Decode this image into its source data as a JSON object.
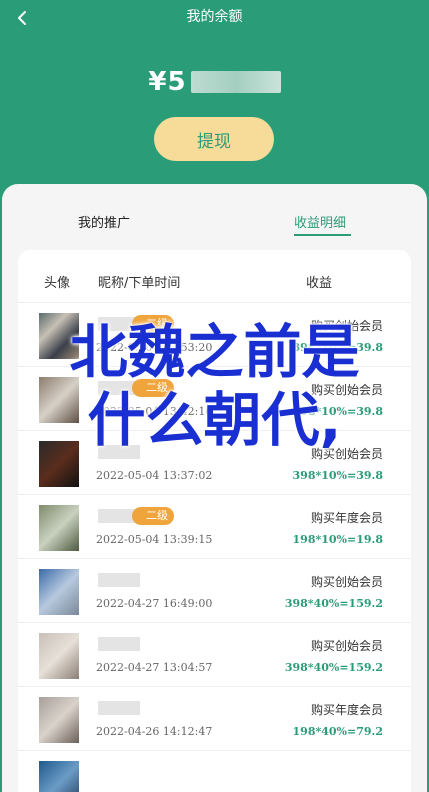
{
  "header": {
    "title": "我的余额"
  },
  "balance": {
    "amount": "¥5"
  },
  "buttons": {
    "withdraw": "提现"
  },
  "tabs": [
    {
      "label": "我的推广"
    },
    {
      "label": "收益明细"
    }
  ],
  "table": {
    "headers": [
      "头像",
      "昵称/下单时间",
      "收益"
    ],
    "rows": [
      {
        "level": "二级",
        "time": "2022-05-04 13:53:20",
        "desc": "购买创始会员",
        "calc": "398*10%=39.8"
      },
      {
        "level": "二级",
        "time": "2022-05-04 13:42:16",
        "desc": "购买创始会员",
        "calc": "398*10%=39.8"
      },
      {
        "level": "",
        "time": "2022-05-04 13:37:02",
        "desc": "购买创始会员",
        "calc": "398*10%=39.8"
      },
      {
        "level": "二级",
        "time": "2022-05-04 13:39:15",
        "desc": "购买年度会员",
        "calc": "198*10%=19.8"
      },
      {
        "level": "",
        "time": "2022-04-27 16:49:00",
        "desc": "购买创始会员",
        "calc": "398*40%=159.2"
      },
      {
        "level": "",
        "time": "2022-04-27 13:04:57",
        "desc": "购买创始会员",
        "calc": "398*40%=159.2"
      },
      {
        "level": "",
        "time": "2022-04-26 14:12:47",
        "desc": "购买年度会员",
        "calc": "198*40%=79.2"
      }
    ]
  },
  "watermark": {
    "line1": "北魏之前是",
    "line2": "什么朝代,"
  },
  "colors": {
    "primary": "#2a9d78",
    "accent": "#f7dc99",
    "badge": "#f0a53c",
    "watermark": "#1a2fd1"
  }
}
